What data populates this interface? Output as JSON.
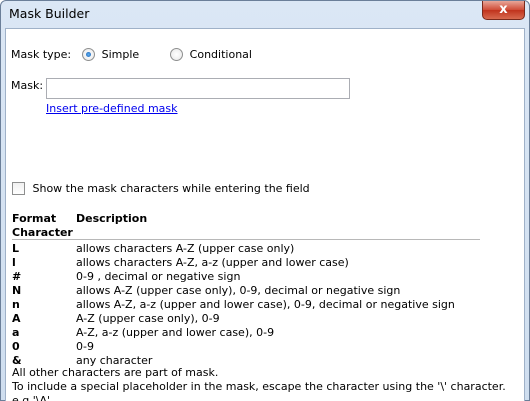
{
  "window": {
    "title": "Mask Builder",
    "close_glyph": "x"
  },
  "mask_type": {
    "label": "Mask type:",
    "options": [
      {
        "label": "Simple",
        "selected": true
      },
      {
        "label": "Conditional",
        "selected": false
      }
    ]
  },
  "mask": {
    "label": "Mask:",
    "value": "",
    "link": "Insert pre-defined mask"
  },
  "show_chars": {
    "label": "Show the mask characters while entering the field",
    "checked": false
  },
  "table": {
    "headers": {
      "format_line1": "Format",
      "format_line2": "Character",
      "description": "Description"
    },
    "rows": [
      {
        "fmt": "L",
        "desc": "allows characters A-Z (upper case only)"
      },
      {
        "fmt": "l",
        "desc": "allows characters A-Z, a-z (upper and lower case)"
      },
      {
        "fmt": "#",
        "desc": "0-9 , decimal or negative sign"
      },
      {
        "fmt": "N",
        "desc": "allows A-Z (upper case only), 0-9, decimal or negative sign"
      },
      {
        "fmt": "n",
        "desc": "allows A-Z, a-z (upper and lower case), 0-9, decimal or negative sign"
      },
      {
        "fmt": "A",
        "desc": "A-Z (upper case only), 0-9"
      },
      {
        "fmt": "a",
        "desc": "A-Z, a-z (upper and lower case), 0-9"
      },
      {
        "fmt": "0",
        "desc": "0-9"
      },
      {
        "fmt": "&",
        "desc": "any character"
      }
    ]
  },
  "notes": {
    "line1": "All other characters are part of mask.",
    "line2": "To include a special placeholder in the mask, escape the character using the '\\' character. e.g '\\A'"
  }
}
